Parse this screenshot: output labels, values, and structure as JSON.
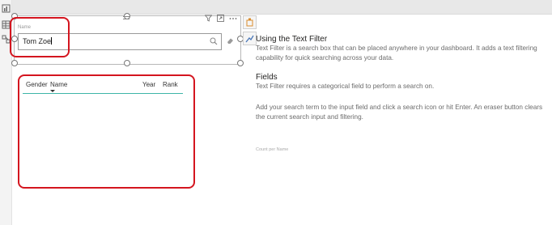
{
  "text_filter": {
    "field_caption": "Name",
    "search_value": "Tom Zoe"
  },
  "table": {
    "columns": [
      "Gender",
      "Name",
      "Year",
      "Rank"
    ],
    "sorted_column": "Name"
  },
  "help": {
    "section1_title": "Using the Text Filter",
    "section1_body": "Text Filter is a search box that can be placed anywhere in your dashboard. It adds a text filtering capability for quick searching across your data.",
    "section2_title": "Fields",
    "section2_body": "Text Filter requires a categorical field to perform a search on.",
    "section3_body": "Add your search term to the input field and click a search icon or hit Enter. An eraser button clears the current search input and filtering.",
    "count_label": "Count per Name"
  },
  "colors": {
    "highlight": "#d4151f",
    "header_rule": "#3fb6a8"
  },
  "icons": [
    "report-view-icon",
    "table-view-icon",
    "model-view-icon",
    "filter-icon",
    "focus-mode-icon",
    "more-options-icon",
    "search-icon",
    "eraser-icon",
    "format-pane-icon",
    "analytics-pane-icon"
  ]
}
